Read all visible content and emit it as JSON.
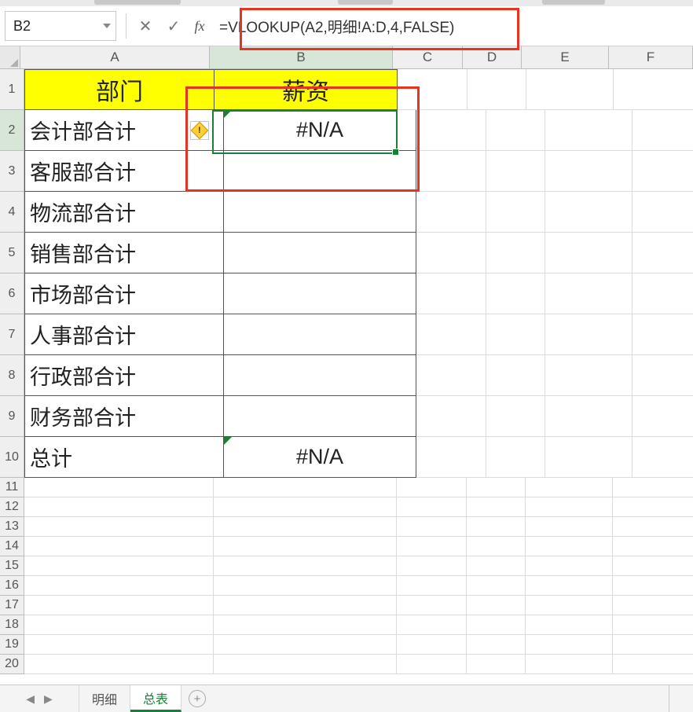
{
  "name_box": "B2",
  "formula": "=VLOOKUP(A2,明细!A:D,4,FALSE)",
  "columns": [
    "A",
    "B",
    "C",
    "D",
    "E",
    "F"
  ],
  "headers": {
    "A": "部门",
    "B": "薪资"
  },
  "rows": [
    {
      "n": 1
    },
    {
      "n": 2,
      "A": "会计部合计",
      "B": "#N/A"
    },
    {
      "n": 3,
      "A": "客服部合计",
      "B": ""
    },
    {
      "n": 4,
      "A": "物流部合计",
      "B": ""
    },
    {
      "n": 5,
      "A": "销售部合计",
      "B": ""
    },
    {
      "n": 6,
      "A": "市场部合计",
      "B": ""
    },
    {
      "n": 7,
      "A": "人事部合计",
      "B": ""
    },
    {
      "n": 8,
      "A": "行政部合计",
      "B": ""
    },
    {
      "n": 9,
      "A": "财务部合计",
      "B": ""
    },
    {
      "n": 10,
      "A": "总计",
      "B": "#N/A"
    }
  ],
  "blank_rows": [
    11,
    12,
    13,
    14,
    15,
    16,
    17,
    18,
    19,
    20
  ],
  "sheets": {
    "items": [
      "明细",
      "总表"
    ],
    "active": "总表"
  },
  "icons": {
    "cancel": "✕",
    "enter": "✓",
    "add": "+",
    "nav_l": "◀",
    "nav_r": "▶"
  }
}
